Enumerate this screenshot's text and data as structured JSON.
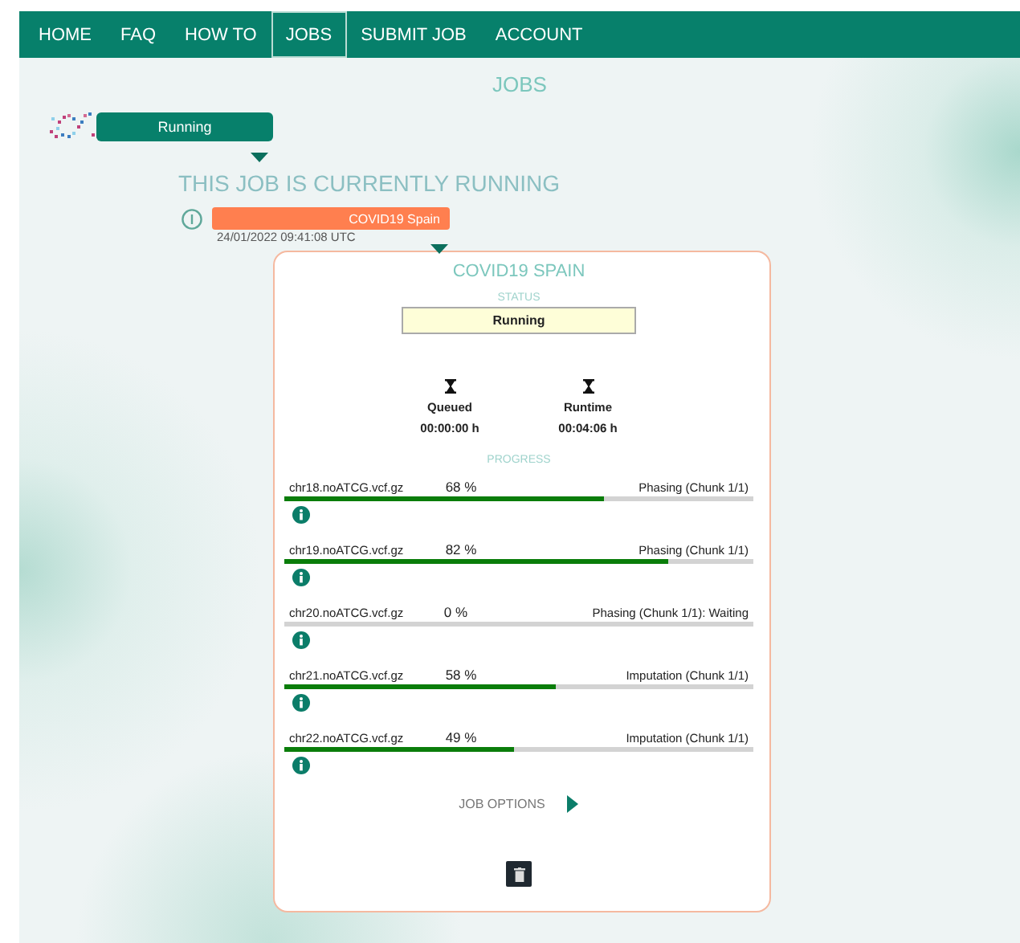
{
  "nav": [
    {
      "label": "HOME",
      "selected": false
    },
    {
      "label": "FAQ",
      "selected": false
    },
    {
      "label": "HOW TO",
      "selected": false
    },
    {
      "label": "JOBS",
      "selected": true
    },
    {
      "label": "SUBMIT JOB",
      "selected": false
    },
    {
      "label": "ACCOUNT",
      "selected": false
    }
  ],
  "page_title": "JOBS",
  "job_state_badge": "Running",
  "heading": "THIS JOB IS CURRENTLY RUNNING",
  "job": {
    "name": "COVID19 Spain",
    "date": "24/01/2022 09:41:08 UTC"
  },
  "card": {
    "title": "COVID19 SPAIN",
    "status_label": "STATUS",
    "status": "Running",
    "timers": [
      {
        "label": "Queued",
        "value": "00:00:00 h"
      },
      {
        "label": "Runtime",
        "value": "00:04:06 h"
      }
    ],
    "progress_label": "PROGRESS",
    "files": [
      {
        "name": "chr18.noATCG.vcf.gz",
        "percent": "68 %",
        "step": "Phasing (Chunk 1/1)",
        "level": 0.68
      },
      {
        "name": "chr19.noATCG.vcf.gz",
        "percent": "82 %",
        "step": "Phasing (Chunk 1/1)",
        "level": 0.82
      },
      {
        "name": "chr20.noATCG.vcf.gz",
        "percent": "0 %",
        "step": "Phasing (Chunk 1/1): Waiting",
        "level": 0
      },
      {
        "name": "chr21.noATCG.vcf.gz",
        "percent": "58 %",
        "step": "Imputation (Chunk 1/1)",
        "level": 0.58
      },
      {
        "name": "chr22.noATCG.vcf.gz",
        "percent": "49 %",
        "step": "Imputation (Chunk 1/1)",
        "level": 0.49
      }
    ],
    "options_label": "JOB OPTIONS"
  }
}
